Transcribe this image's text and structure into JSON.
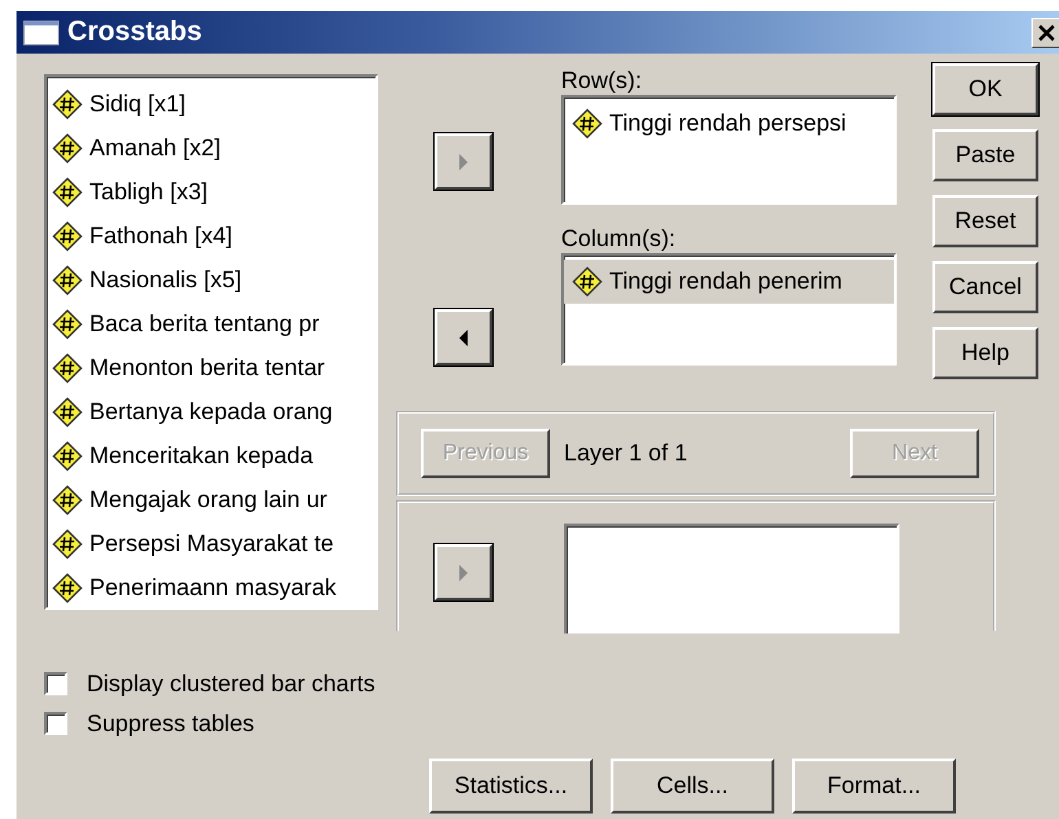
{
  "window": {
    "title": "Crosstabs"
  },
  "variables": [
    "Sidiq [x1]",
    "Amanah [x2]",
    "Tabligh [x3]",
    "Fathonah [x4]",
    "Nasionalis [x5]",
    "Baca berita tentang pr",
    "Menonton berita tentar",
    "Bertanya kepada orang",
    "Menceritakan kepada",
    "Mengajak orang lain ur",
    "Persepsi Masyarakat te",
    "Penerimaann masyarak"
  ],
  "arrow_buttons": [
    {
      "kind": "right",
      "disabled": true
    },
    {
      "kind": "left",
      "disabled": false
    }
  ],
  "rows": {
    "label": "Row(s):",
    "items": [
      {
        "name": "Tinggi rendah persepsi",
        "selected": false
      }
    ]
  },
  "columns": {
    "label": "Column(s):",
    "items": [
      {
        "name": "Tinggi rendah penerim",
        "selected": true
      }
    ]
  },
  "buttons": [
    {
      "label": "OK",
      "default": true
    },
    {
      "label": "Paste",
      "default": false
    },
    {
      "label": "Reset",
      "default": false
    },
    {
      "label": "Cancel",
      "default": false
    },
    {
      "label": "Help",
      "default": false
    }
  ],
  "layer": {
    "previous": {
      "label": "Previous",
      "disabled": true
    },
    "text": "Layer 1 of 1",
    "next": {
      "label": "Next",
      "disabled": true
    },
    "arrow": {
      "kind": "right",
      "disabled": true
    }
  },
  "options": [
    {
      "label": "Display clustered bar charts",
      "checked": false
    },
    {
      "label": "Suppress tables",
      "checked": false
    }
  ],
  "bottom_buttons": [
    "Statistics...",
    "Cells...",
    "Format..."
  ]
}
